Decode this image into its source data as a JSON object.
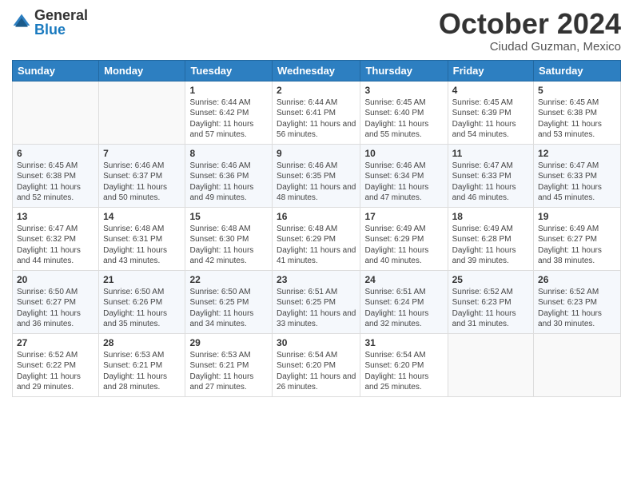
{
  "header": {
    "logo_general": "General",
    "logo_blue": "Blue",
    "month_title": "October 2024",
    "subtitle": "Ciudad Guzman, Mexico"
  },
  "days_of_week": [
    "Sunday",
    "Monday",
    "Tuesday",
    "Wednesday",
    "Thursday",
    "Friday",
    "Saturday"
  ],
  "weeks": [
    [
      {
        "day": "",
        "info": ""
      },
      {
        "day": "",
        "info": ""
      },
      {
        "day": "1",
        "info": "Sunrise: 6:44 AM\nSunset: 6:42 PM\nDaylight: 11 hours and 57 minutes."
      },
      {
        "day": "2",
        "info": "Sunrise: 6:44 AM\nSunset: 6:41 PM\nDaylight: 11 hours and 56 minutes."
      },
      {
        "day": "3",
        "info": "Sunrise: 6:45 AM\nSunset: 6:40 PM\nDaylight: 11 hours and 55 minutes."
      },
      {
        "day": "4",
        "info": "Sunrise: 6:45 AM\nSunset: 6:39 PM\nDaylight: 11 hours and 54 minutes."
      },
      {
        "day": "5",
        "info": "Sunrise: 6:45 AM\nSunset: 6:38 PM\nDaylight: 11 hours and 53 minutes."
      }
    ],
    [
      {
        "day": "6",
        "info": "Sunrise: 6:45 AM\nSunset: 6:38 PM\nDaylight: 11 hours and 52 minutes."
      },
      {
        "day": "7",
        "info": "Sunrise: 6:46 AM\nSunset: 6:37 PM\nDaylight: 11 hours and 50 minutes."
      },
      {
        "day": "8",
        "info": "Sunrise: 6:46 AM\nSunset: 6:36 PM\nDaylight: 11 hours and 49 minutes."
      },
      {
        "day": "9",
        "info": "Sunrise: 6:46 AM\nSunset: 6:35 PM\nDaylight: 11 hours and 48 minutes."
      },
      {
        "day": "10",
        "info": "Sunrise: 6:46 AM\nSunset: 6:34 PM\nDaylight: 11 hours and 47 minutes."
      },
      {
        "day": "11",
        "info": "Sunrise: 6:47 AM\nSunset: 6:33 PM\nDaylight: 11 hours and 46 minutes."
      },
      {
        "day": "12",
        "info": "Sunrise: 6:47 AM\nSunset: 6:33 PM\nDaylight: 11 hours and 45 minutes."
      }
    ],
    [
      {
        "day": "13",
        "info": "Sunrise: 6:47 AM\nSunset: 6:32 PM\nDaylight: 11 hours and 44 minutes."
      },
      {
        "day": "14",
        "info": "Sunrise: 6:48 AM\nSunset: 6:31 PM\nDaylight: 11 hours and 43 minutes."
      },
      {
        "day": "15",
        "info": "Sunrise: 6:48 AM\nSunset: 6:30 PM\nDaylight: 11 hours and 42 minutes."
      },
      {
        "day": "16",
        "info": "Sunrise: 6:48 AM\nSunset: 6:29 PM\nDaylight: 11 hours and 41 minutes."
      },
      {
        "day": "17",
        "info": "Sunrise: 6:49 AM\nSunset: 6:29 PM\nDaylight: 11 hours and 40 minutes."
      },
      {
        "day": "18",
        "info": "Sunrise: 6:49 AM\nSunset: 6:28 PM\nDaylight: 11 hours and 39 minutes."
      },
      {
        "day": "19",
        "info": "Sunrise: 6:49 AM\nSunset: 6:27 PM\nDaylight: 11 hours and 38 minutes."
      }
    ],
    [
      {
        "day": "20",
        "info": "Sunrise: 6:50 AM\nSunset: 6:27 PM\nDaylight: 11 hours and 36 minutes."
      },
      {
        "day": "21",
        "info": "Sunrise: 6:50 AM\nSunset: 6:26 PM\nDaylight: 11 hours and 35 minutes."
      },
      {
        "day": "22",
        "info": "Sunrise: 6:50 AM\nSunset: 6:25 PM\nDaylight: 11 hours and 34 minutes."
      },
      {
        "day": "23",
        "info": "Sunrise: 6:51 AM\nSunset: 6:25 PM\nDaylight: 11 hours and 33 minutes."
      },
      {
        "day": "24",
        "info": "Sunrise: 6:51 AM\nSunset: 6:24 PM\nDaylight: 11 hours and 32 minutes."
      },
      {
        "day": "25",
        "info": "Sunrise: 6:52 AM\nSunset: 6:23 PM\nDaylight: 11 hours and 31 minutes."
      },
      {
        "day": "26",
        "info": "Sunrise: 6:52 AM\nSunset: 6:23 PM\nDaylight: 11 hours and 30 minutes."
      }
    ],
    [
      {
        "day": "27",
        "info": "Sunrise: 6:52 AM\nSunset: 6:22 PM\nDaylight: 11 hours and 29 minutes."
      },
      {
        "day": "28",
        "info": "Sunrise: 6:53 AM\nSunset: 6:21 PM\nDaylight: 11 hours and 28 minutes."
      },
      {
        "day": "29",
        "info": "Sunrise: 6:53 AM\nSunset: 6:21 PM\nDaylight: 11 hours and 27 minutes."
      },
      {
        "day": "30",
        "info": "Sunrise: 6:54 AM\nSunset: 6:20 PM\nDaylight: 11 hours and 26 minutes."
      },
      {
        "day": "31",
        "info": "Sunrise: 6:54 AM\nSunset: 6:20 PM\nDaylight: 11 hours and 25 minutes."
      },
      {
        "day": "",
        "info": ""
      },
      {
        "day": "",
        "info": ""
      }
    ]
  ]
}
